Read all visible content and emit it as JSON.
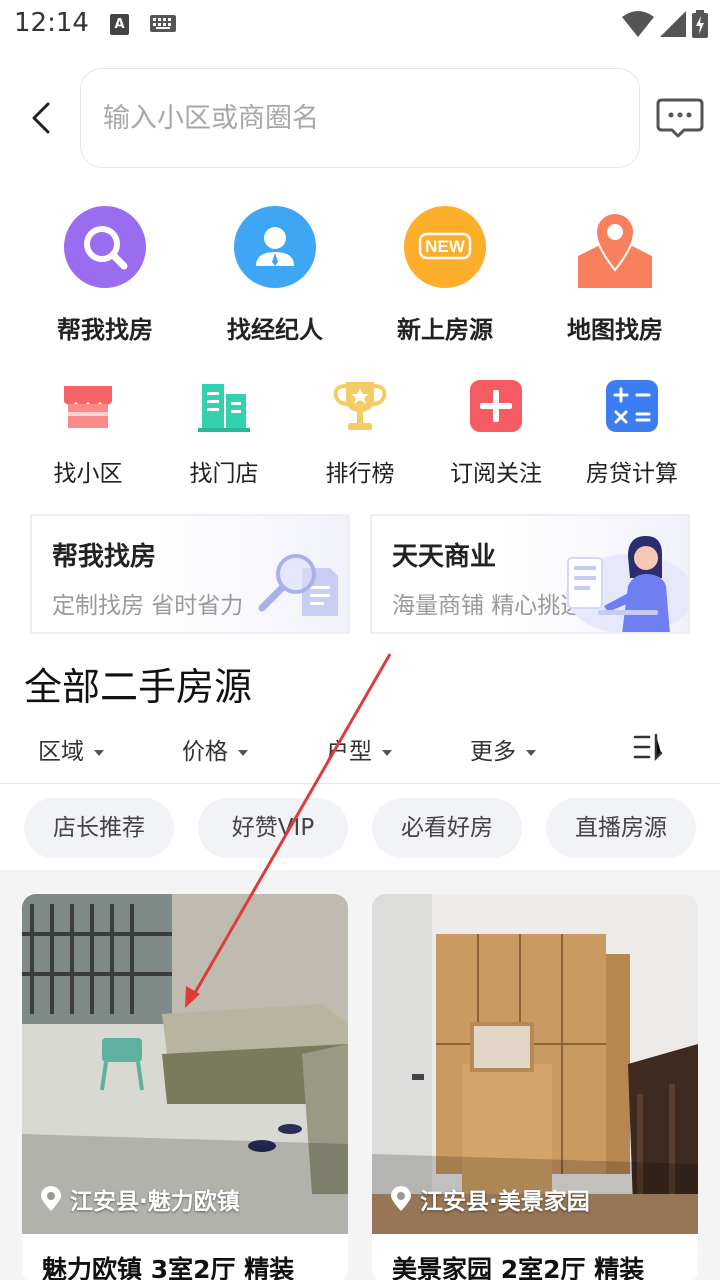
{
  "status_bar": {
    "time": "12:14",
    "a_icon": "A"
  },
  "search": {
    "placeholder": "输入小区或商圈名"
  },
  "primary_shortcuts": [
    {
      "label": "帮我找房",
      "icon": "search-icon",
      "color": "#9a6cf0"
    },
    {
      "label": "找经纪人",
      "icon": "agent-icon",
      "color": "#3ea6f5"
    },
    {
      "label": "新上房源",
      "icon": "new-badge-icon",
      "color": "#fdae2a",
      "badge": "NEW"
    },
    {
      "label": "地图找房",
      "icon": "map-pin-icon",
      "color": "#f8805c"
    }
  ],
  "secondary_shortcuts": [
    {
      "label": "找小区",
      "icon": "store-icon",
      "color": "#f66565"
    },
    {
      "label": "找门店",
      "icon": "building-icon",
      "color": "#33d1b0"
    },
    {
      "label": "排行榜",
      "icon": "trophy-icon",
      "color": "#f3cd63"
    },
    {
      "label": "订阅关注",
      "icon": "plus-icon",
      "color": "#f55b62"
    },
    {
      "label": "房贷计算",
      "icon": "calculator-icon",
      "color": "#3c7ef2"
    }
  ],
  "promos": [
    {
      "title": "帮我找房",
      "subtitle": "定制找房 省时省力"
    },
    {
      "title": "天天商业",
      "subtitle": "海量商铺 精心挑选"
    }
  ],
  "section_title": "全部二手房源",
  "filters": [
    "区域",
    "价格",
    "户型",
    "更多"
  ],
  "tags": [
    "店长推荐",
    "好赞VIP",
    "必看好房",
    "直播房源"
  ],
  "listings": [
    {
      "location": "江安县·魅力欧镇",
      "title": "魅力欧镇 3室2厅 精装"
    },
    {
      "location": "江安县·美景家园",
      "title": "美景家园 2室2厅 精装"
    }
  ],
  "colors": {
    "annotation_arrow": "#e03b3b"
  }
}
